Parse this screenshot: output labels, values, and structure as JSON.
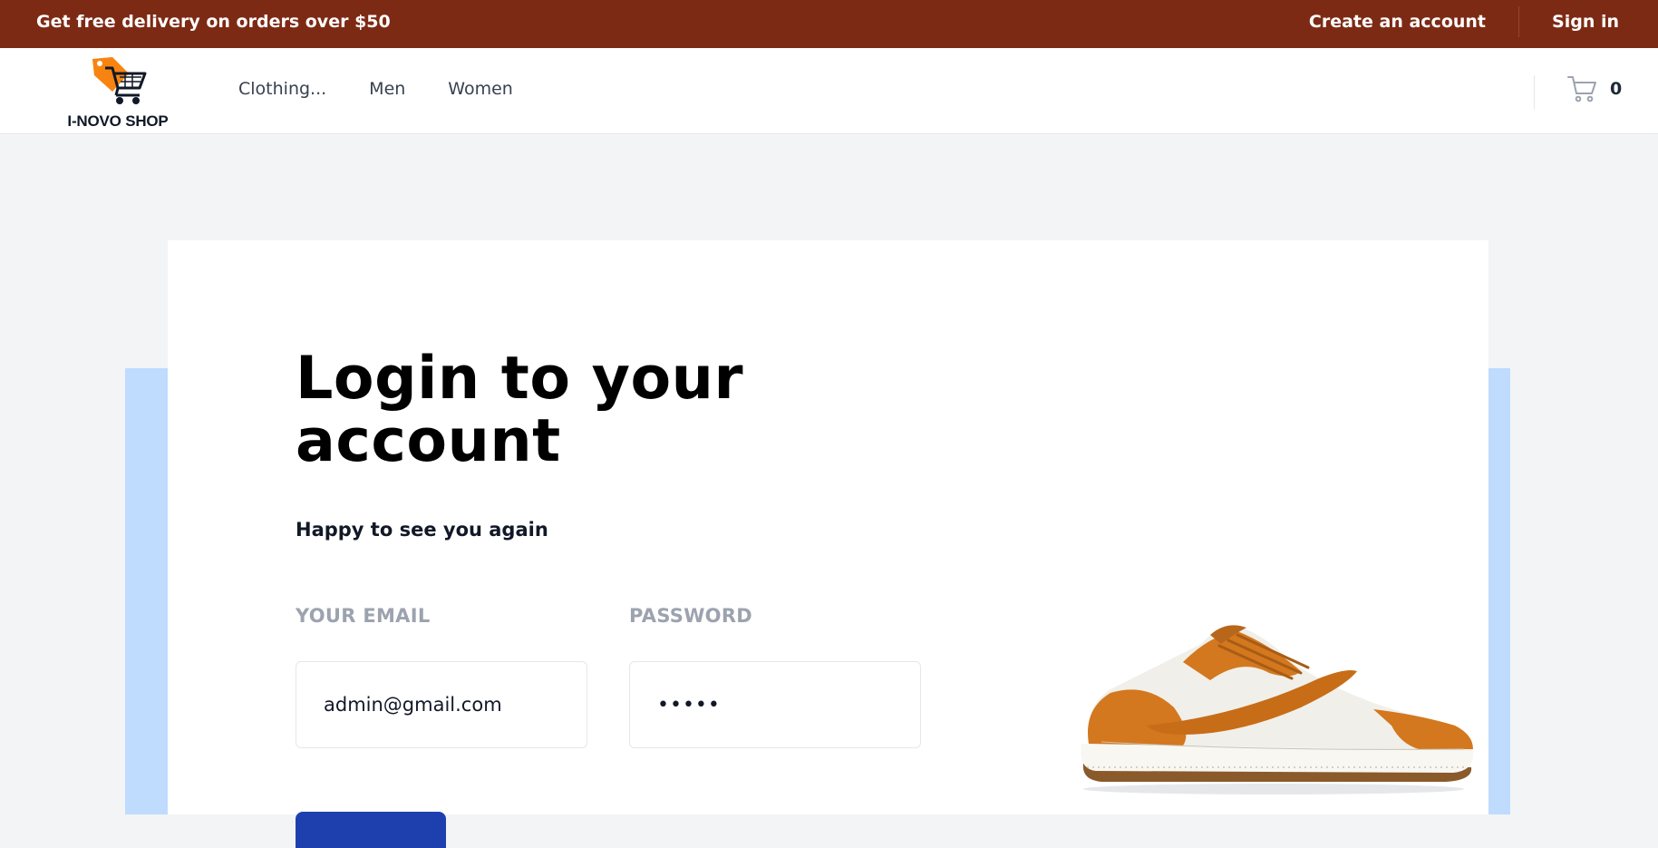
{
  "promo_bar": {
    "message": "Get free delivery on orders over $50",
    "create_account": "Create an account",
    "sign_in": "Sign in",
    "background_color": "#7d2a14"
  },
  "header": {
    "logo_text": "I-NOVO SHOP",
    "nav": [
      "Clothing...",
      "Men",
      "Women"
    ],
    "cart_count": "0"
  },
  "login": {
    "title": "Login to your account",
    "subtitle": "Happy to see you again",
    "email_label": "YOUR EMAIL",
    "email_value": "admin@gmail.com",
    "password_label": "PASSWORD",
    "password_value": "•••••"
  },
  "colors": {
    "accent_blue": "#bfdbfe",
    "button_blue": "#1e40af",
    "shoe_orange": "#d3781e"
  },
  "icons": {
    "logo": "shopping-cart-tag-icon",
    "cart": "shopping-cart-icon"
  }
}
